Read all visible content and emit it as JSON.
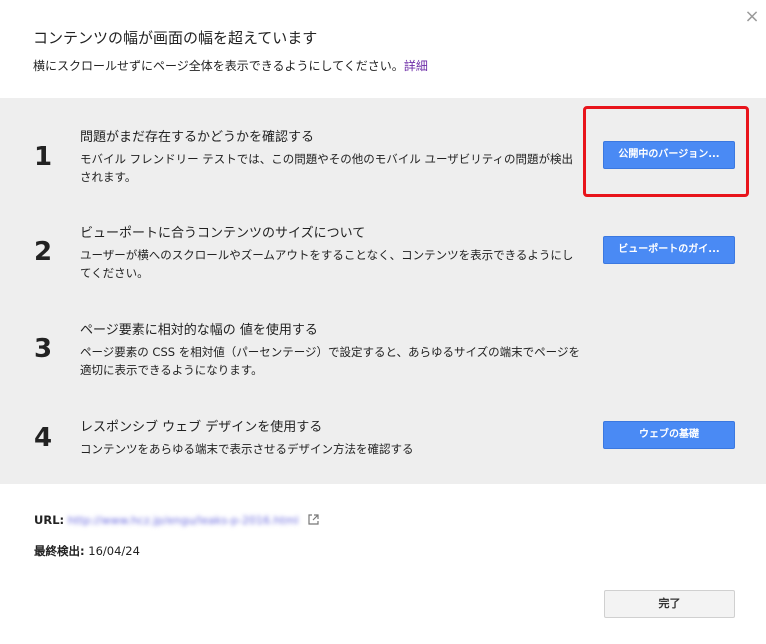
{
  "dialog": {
    "title": "コンテンツの幅が画面の幅を超えています",
    "subtitle": "横にスクロールせずにページ全体を表示できるようにしてください。",
    "subtitle_link": "詳細",
    "close_glyph": "×"
  },
  "steps": [
    {
      "number": "1",
      "title": "問題がまだ存在するかどうかを確認する",
      "description": "モバイル フレンドリー テストでは、この問題やその他のモバイル ユーザビリティの問題が検出されます。",
      "button": "公開中のバージョン..."
    },
    {
      "number": "2",
      "title": "ビューポートに合うコンテンツのサイズについて",
      "description": "ユーザーが横へのスクロールやズームアウトをすることなく、コンテンツを表示できるようにしてください。",
      "button": "ビューポートのガイ..."
    },
    {
      "number": "3",
      "title": "ページ要素に相対的な幅の 値を使用する",
      "description": "ページ要素の CSS を相対値（パーセンテージ）で設定すると、あらゆるサイズの端末でページを適切に表示できるようになります。"
    },
    {
      "number": "4",
      "title": "レスポンシブ ウェブ デザインを使用する",
      "description": "コンテンツをあらゆる端末で表示させるデザイン方法を確認する",
      "button": "ウェブの基礎"
    }
  ],
  "details": {
    "url_label": "URL:",
    "url_value": "http://www.hcz.jp/engu/leaks-p-2016.html",
    "last_detected_label": "最終検出:",
    "last_detected_value": "16/04/24"
  },
  "footer": {
    "done_label": "完了"
  },
  "colors": {
    "accent_button": "#4a8af4",
    "highlight_box": "#e8141b",
    "steps_background": "#eeeeee"
  }
}
